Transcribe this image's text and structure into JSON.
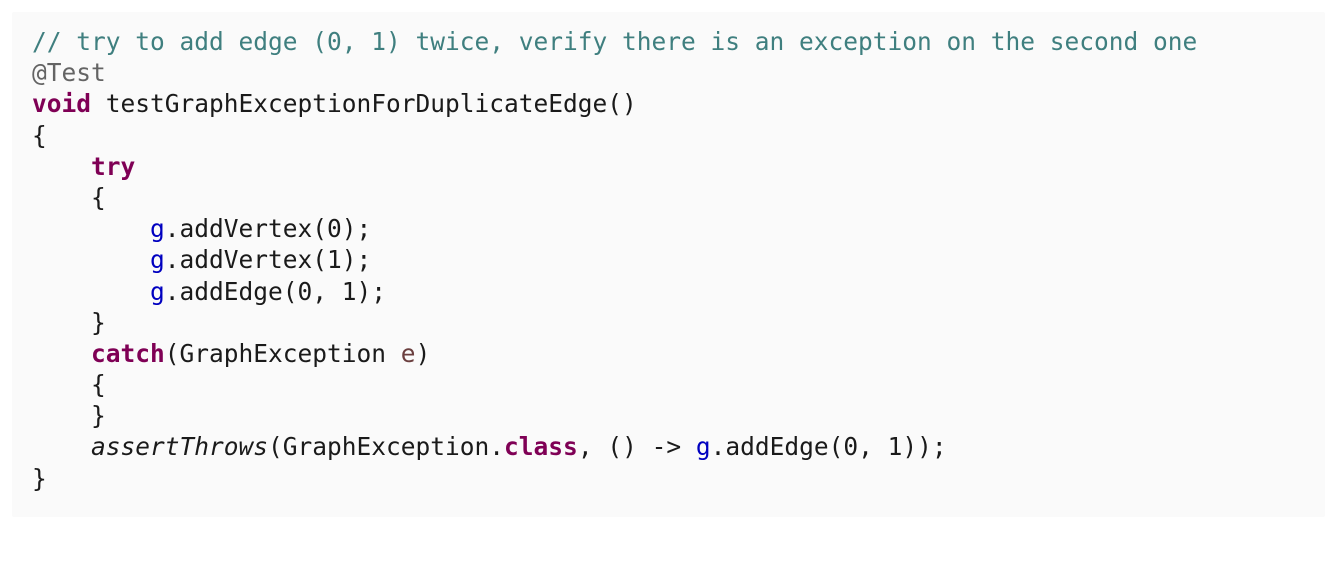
{
  "code": {
    "comment": "// try to add edge (0, 1) twice, verify there is an exception on the second one",
    "annotation": "@Test",
    "kw_void": "void",
    "method_signature": " testGraphExceptionForDuplicateEdge()",
    "brace_open": "{",
    "kw_try": "try",
    "var_g": "g",
    "call_add_vertex_0": ".addVertex(0);",
    "call_add_vertex_1": ".addVertex(1);",
    "call_add_edge": ".addEdge(0, 1);",
    "brace_close": "}",
    "kw_catch": "catch",
    "catch_type": "(GraphException ",
    "catch_param": "e",
    "catch_close": ")",
    "assert_call": "assertThrows",
    "assert_arg_type": "(GraphException.",
    "kw_class": "class",
    "assert_lambda": ", () -> ",
    "assert_tail": ".addEdge(0, 1));"
  },
  "colors": {
    "comment": "#3f7f7f",
    "annotation": "#646464",
    "keyword": "#7f0055",
    "field": "#0000c0",
    "parameter": "#6a3e3e",
    "text": "#1a1a1a",
    "background": "#fafafa"
  }
}
